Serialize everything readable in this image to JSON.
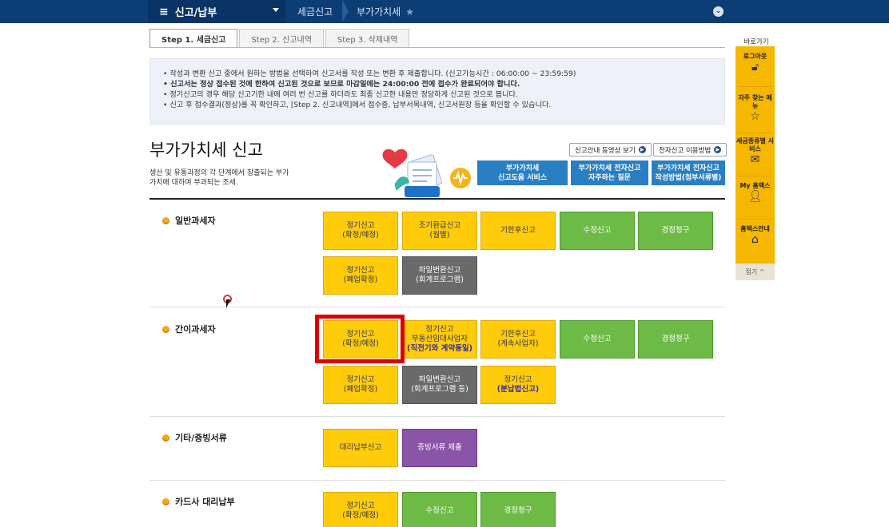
{
  "topbar": {
    "menu_title": "신고/납부",
    "crumb1": "세금신고",
    "crumb2": "부가가치세"
  },
  "tabs": [
    {
      "label": "Step 1. 세금신고"
    },
    {
      "label": "Step 2. 신고내역"
    },
    {
      "label": "Step 3. 삭제내역"
    }
  ],
  "notice": [
    "작성과 변환 신고 중에서 원하는 방법을 선택하여 신고서를 작성 또는 변환 후 제출합니다. (신고가능시간 : 06:00:00 ~ 23:59:59)",
    "신고서는 정상 접수된 것에 한하여 신고된 것으로 보므로 마감일에는 24:00:00 전에 접수가 완료되어야 합니다.",
    "정기신고의 경우 해당 신고기한 내에 여러 번 신고를 하더라도 최종 신고한 내용만 정당하게 신고된 것으로 봅니다.",
    "신고 후 접수결과(정상)를 꼭 확인하고, [Step 2. 신고내역]에서 접수증, 납부서목내역, 신고서원장 등을 확인할 수 있습니다."
  ],
  "page": {
    "title": "부가가치세 신고",
    "subtitle": "생산 및 유통과정의 각 단계에서 창출되는 부가가치에 대하여 부과되는 조세."
  },
  "links": {
    "video": "신고안내 동영상 보기",
    "howto": "전자신고 이용방법"
  },
  "blue_buttons": [
    {
      "l1": "부가가치세",
      "l2": "신고도움 서비스"
    },
    {
      "l1": "부가가치세 전자신고",
      "l2": "자주하는 질문"
    },
    {
      "l1": "부가가치세 전자신고",
      "l2": "작성방법(첨부서류별)"
    }
  ],
  "sections": {
    "general": {
      "label": "일반과세자",
      "buttons": [
        {
          "l1": "정기신고",
          "l2": "(확정/예정)"
        },
        {
          "l1": "조기환급신고",
          "l2": "(월별)"
        },
        {
          "l1": "기한후신고",
          "l2": ""
        },
        {
          "l1": "수정신고",
          "l2": ""
        },
        {
          "l1": "경정청구",
          "l2": ""
        },
        {
          "l1": "정기신고",
          "l2": "(폐업확정)"
        },
        {
          "l1": "파일변환신고",
          "l2": "(회계프로그램)"
        }
      ]
    },
    "simple": {
      "label": "간이과세자",
      "buttons": [
        {
          "l1": "정기신고",
          "l2": "(확정/예정)"
        },
        {
          "l1": "정기신고",
          "l2": "부동산임대사업자",
          "l3": "(직전기와 계약동일)"
        },
        {
          "l1": "기한후신고",
          "l2": "(계속사업자)"
        },
        {
          "l1": "수정신고",
          "l2": ""
        },
        {
          "l1": "경정청구",
          "l2": ""
        },
        {
          "l1": "정기신고",
          "l2": "(폐업확정)"
        },
        {
          "l1": "파일변환신고",
          "l2": "(회계프로그램 등)"
        },
        {
          "l1": "정기신고",
          "l2": "(분납법신고)"
        }
      ]
    },
    "etc": {
      "label": "기타/증빙서류",
      "buttons": [
        {
          "l1": "대리납부신고",
          "l2": ""
        },
        {
          "l1": "증빙서류 제출",
          "l2": ""
        }
      ]
    },
    "card": {
      "label": "카드사 대리납부",
      "buttons": [
        {
          "l1": "정기신고",
          "l2": "(확정/예정)"
        },
        {
          "l1": "수정신고",
          "l2": ""
        },
        {
          "l1": "경정청구",
          "l2": ""
        }
      ]
    }
  },
  "sidebar": {
    "title": "바로가기",
    "items": [
      {
        "label": "로그아웃"
      },
      {
        "label": "자주 찾는 메뉴"
      },
      {
        "label": "세금종류별 서비스"
      },
      {
        "label": "My 홈택스"
      },
      {
        "label": "홈택스안내"
      }
    ],
    "fold": "접기 ^"
  }
}
